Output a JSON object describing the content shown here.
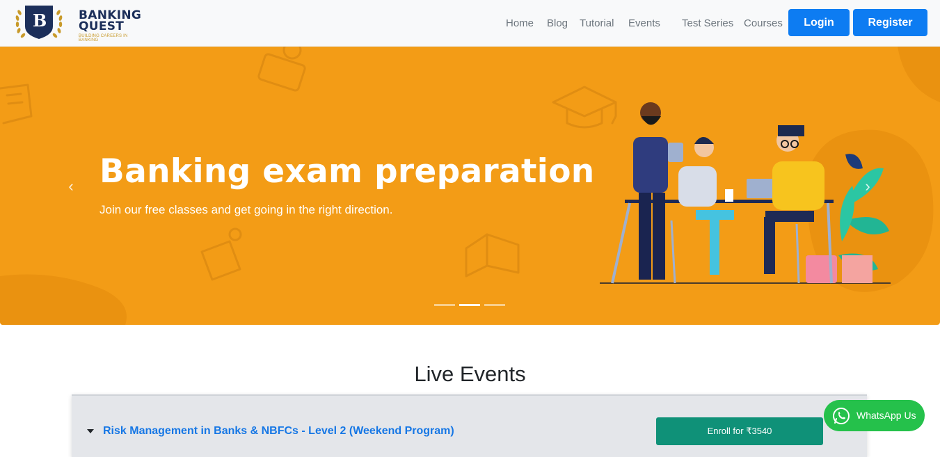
{
  "brand": {
    "logo_letter": "B",
    "name_line1": "BANKING",
    "name_line2": "QUEST",
    "tagline": "BUILDING CAREERS IN BANKING"
  },
  "nav": {
    "links": [
      "Home",
      "Blog",
      "Tutorial",
      "Events",
      "Test Series",
      "Courses"
    ],
    "login_label": "Login",
    "register_label": "Register"
  },
  "hero": {
    "title": "Banking exam preparation",
    "subtitle": "Join our free classes and get going in the right direction.",
    "prev_icon": "chevron-left-icon",
    "next_icon": "chevron-right-icon",
    "slide_count": 3,
    "active_slide": 2
  },
  "live_events": {
    "heading": "Live Events",
    "items": [
      {
        "title": "Risk Management in Banks & NBFCs - Level 2 (Weekend Program)",
        "enroll_label": "Enroll for ₹3540"
      }
    ]
  },
  "whatsapp": {
    "label": "WhatsApp Us",
    "icon": "whatsapp-icon"
  },
  "colors": {
    "primary": "#0d7cf2",
    "hero_bg": "#f39c16",
    "brand_navy": "#1c2f5a",
    "enroll": "#0f9178",
    "whatsapp": "#25c14b"
  }
}
